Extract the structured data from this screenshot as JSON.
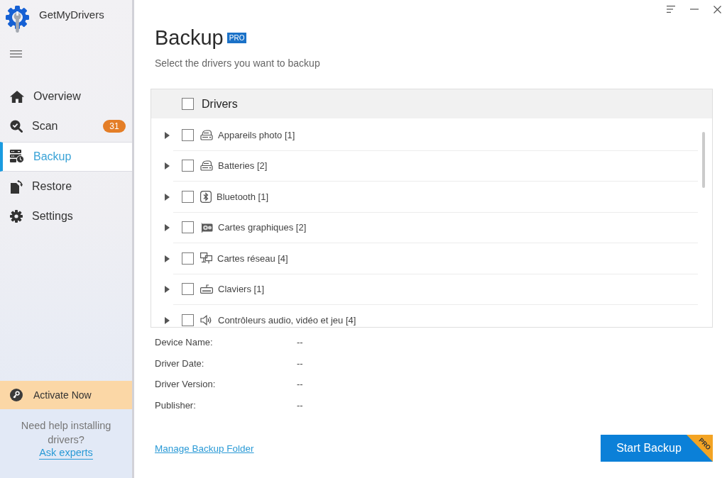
{
  "app": {
    "name": "GetMyDrivers"
  },
  "sidebar": {
    "items": [
      {
        "kind": "home",
        "label": "Overview",
        "selected": false
      },
      {
        "kind": "scan",
        "label": "Scan",
        "selected": false,
        "badge": "31"
      },
      {
        "kind": "backup",
        "label": "Backup",
        "selected": true
      },
      {
        "kind": "restore",
        "label": "Restore",
        "selected": false
      },
      {
        "kind": "settings",
        "label": "Settings",
        "selected": false
      }
    ],
    "activate_button": "Activate Now",
    "help_text": "Need help installing drivers?",
    "help_link": "Ask experts"
  },
  "page": {
    "title": "Backup",
    "title_badge": "PRO",
    "subtitle": "Select the drivers you want to backup"
  },
  "drivers": {
    "header": {
      "label": "Drivers",
      "checked": false
    },
    "rows": [
      {
        "kind": "device",
        "label": "Appareils photo [1]",
        "checked": false,
        "expanded": false
      },
      {
        "kind": "device",
        "label": "Batteries [2]",
        "checked": false,
        "expanded": false
      },
      {
        "kind": "bluetooth",
        "label": "Bluetooth [1]",
        "checked": false,
        "expanded": false
      },
      {
        "kind": "display",
        "label": "Cartes graphiques [2]",
        "checked": false,
        "expanded": false
      },
      {
        "kind": "network",
        "label": "Cartes réseau [4]",
        "checked": false,
        "expanded": false
      },
      {
        "kind": "keyboard",
        "label": "Claviers [1]",
        "checked": false,
        "expanded": false
      },
      {
        "kind": "audio",
        "label": "Contrôleurs audio, vidéo et jeu [4]",
        "checked": false,
        "expanded": false
      }
    ]
  },
  "details": [
    {
      "label": "Device Name:",
      "value": "--"
    },
    {
      "label": "Driver Date:",
      "value": "--"
    },
    {
      "label": "Driver Version:",
      "value": "--"
    },
    {
      "label": "Publisher:",
      "value": "--"
    }
  ],
  "footer": {
    "link": "Manage Backup Folder",
    "button": "Start Backup",
    "button_badge": "PRO"
  }
}
